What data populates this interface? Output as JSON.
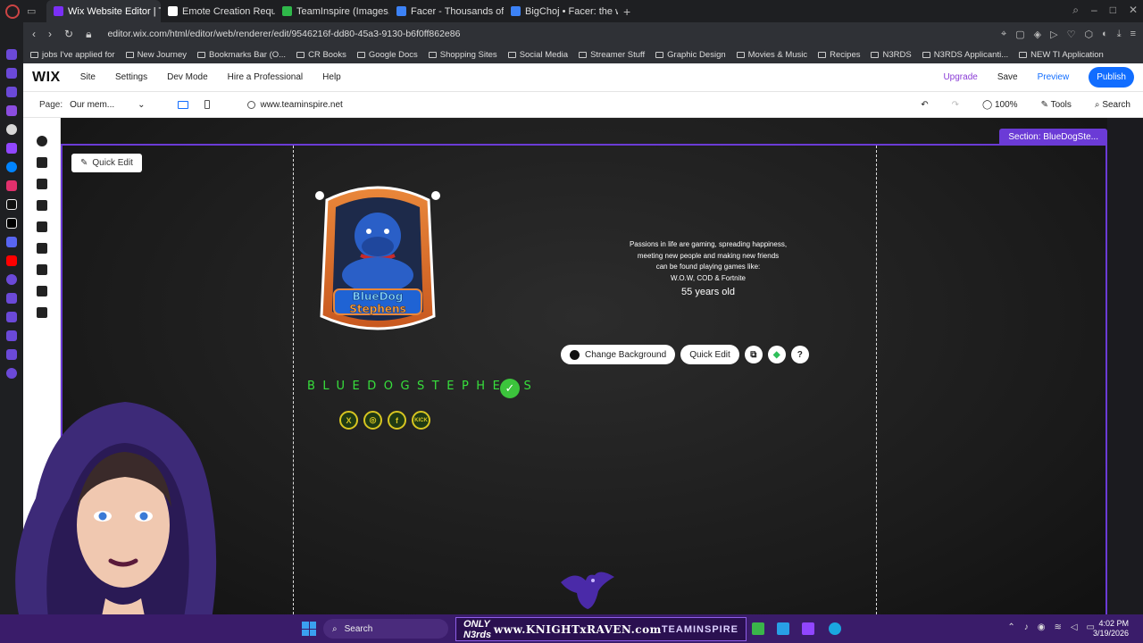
{
  "browser": {
    "tabs": [
      {
        "title": "Wix Website Editor | Team",
        "active": true,
        "favicon_color": "#7b2ff7"
      },
      {
        "title": "Emote Creation Request",
        "active": false,
        "favicon_color": "#ffffff"
      },
      {
        "title": "TeamInspire (Images, Pos",
        "active": false,
        "favicon_color": "#2fb84a"
      },
      {
        "title": "Facer - Thousands of FRE",
        "active": false,
        "favicon_color": "#3c82f6"
      },
      {
        "title": "BigChoj • Facer: the world",
        "active": false,
        "favicon_color": "#3c82f6"
      }
    ],
    "url": "editor.wix.com/html/editor/web/renderer/edit/9546216f-dd80-45a3-9130-b6f0ff862e86",
    "bookmarks": [
      "jobs I've applied for",
      "New Journey",
      "Bookmarks Bar (O...",
      "CR Books",
      "Google Docs",
      "Shopping Sites",
      "Social Media",
      "Streamer Stuff",
      "Graphic Design",
      "Movies & Music",
      "Recipes",
      "N3RDS",
      "N3RDS Applicanti...",
      "NEW TI Application"
    ]
  },
  "wix": {
    "logo": "WIX",
    "menu": [
      "Site",
      "Settings",
      "Dev Mode",
      "Hire a Professional",
      "Help"
    ],
    "upgrade": "Upgrade",
    "save": "Save",
    "preview": "Preview",
    "publish": "Publish",
    "page_label": "Page:",
    "page_value": "Our mem...",
    "domain": "www.teaminspire.net",
    "zoom": "100%",
    "tools": "Tools",
    "search": "Search"
  },
  "canvas": {
    "section_label": "Section: BlueDogSte...",
    "quick_edit_top": "Quick Edit",
    "logo_alt": "BlueDog Stephens",
    "bio_lines": [
      "Passions in life are gaming, spreading happiness,",
      "meeting new people and making new friends",
      "can be found playing games like:",
      "W.O.W, COD & Fortnite"
    ],
    "age": "55 years old",
    "toolbar": {
      "change_background": "Change Background",
      "quick_edit": "Quick Edit",
      "help": "?"
    },
    "username": "BLUEDOGSTEPHENS",
    "socials": [
      "X",
      "◎",
      "f",
      "KICK"
    ]
  },
  "taskbar": {
    "search": "Search",
    "banner": {
      "left": "ONLY N3rds",
      "center": "www.KNIGHTxRAVEN.com",
      "right": "TEAMINSPIRE"
    },
    "time": "4:02 PM",
    "date": "3/19/2026"
  }
}
